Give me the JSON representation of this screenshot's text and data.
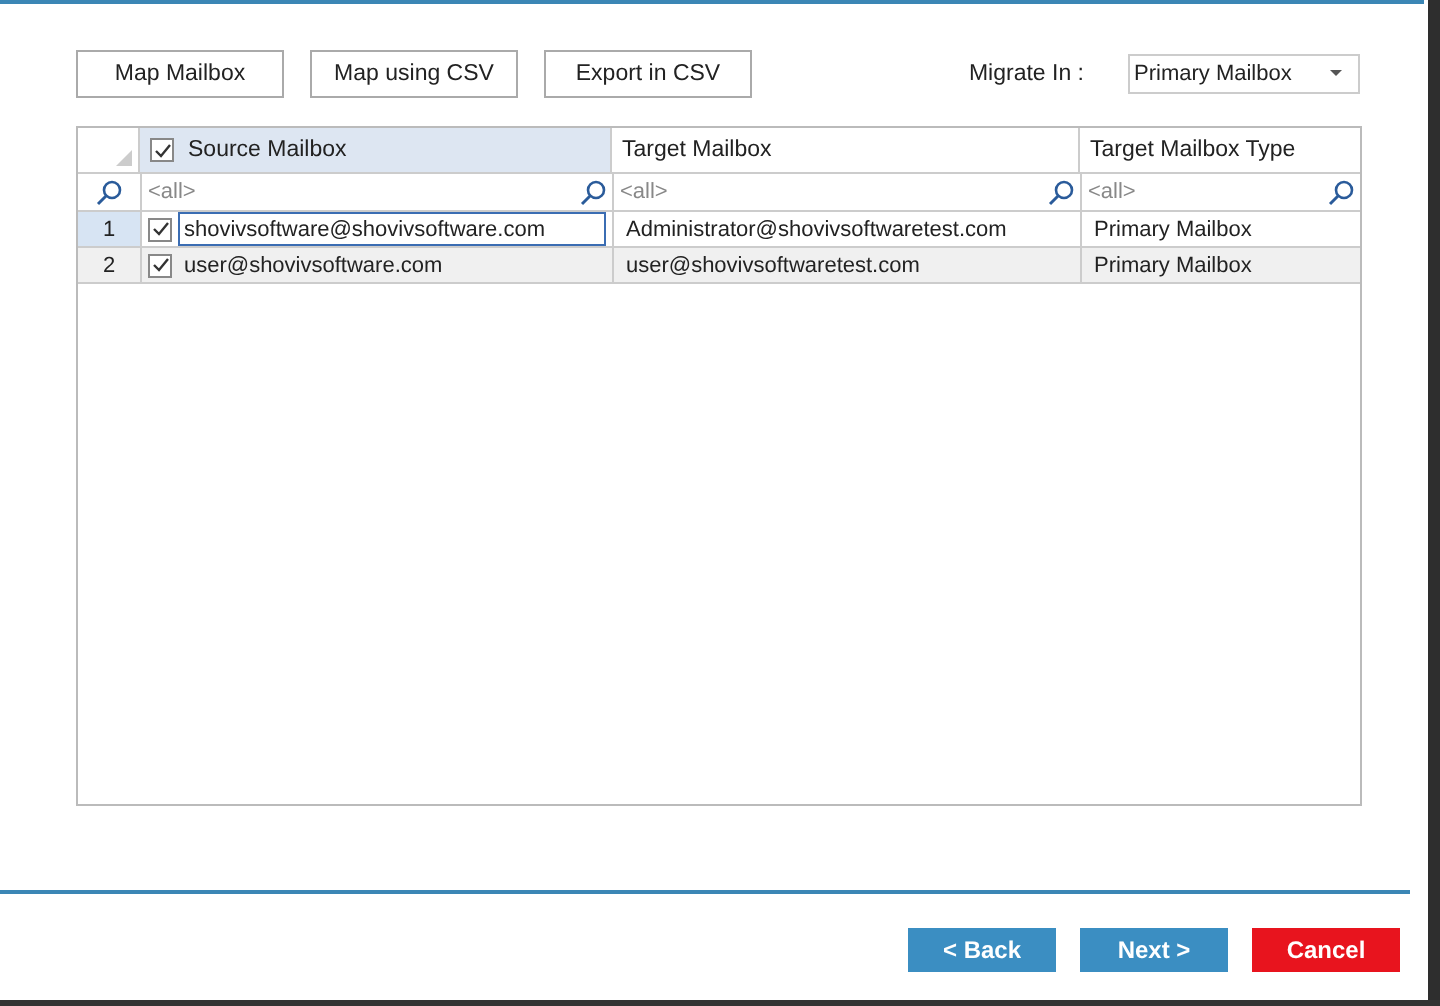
{
  "toolbar": {
    "buttons": [
      "Map Mailbox",
      "Map using CSV",
      "Export in CSV"
    ],
    "migrate_label": "Migrate In :",
    "migrate_dropdown": {
      "value": "Primary Mailbox"
    }
  },
  "grid": {
    "header_checked": true,
    "columns": [
      {
        "label": "Source Mailbox",
        "selected": true
      },
      {
        "label": "Target Mailbox",
        "selected": false
      },
      {
        "label": "Target Mailbox Type",
        "selected": false
      }
    ],
    "filters": [
      "<all>",
      "<all>",
      "<all>"
    ],
    "rows": [
      {
        "number": "1",
        "checked": true,
        "selected": true,
        "cells": [
          "shovivsoftware@shovivsoftware.com",
          "Administrator@shovivsoftwaretest.com",
          "Primary Mailbox"
        ]
      },
      {
        "number": "2",
        "checked": true,
        "selected": false,
        "cells": [
          "user@shovivsoftware.com",
          "user@shovivsoftwaretest.com",
          "Primary Mailbox"
        ]
      }
    ]
  },
  "footer_buttons": [
    {
      "label": "< Back",
      "kind": "nav"
    },
    {
      "label": "Next >",
      "kind": "nav"
    },
    {
      "label": "Cancel",
      "kind": "danger"
    }
  ]
}
